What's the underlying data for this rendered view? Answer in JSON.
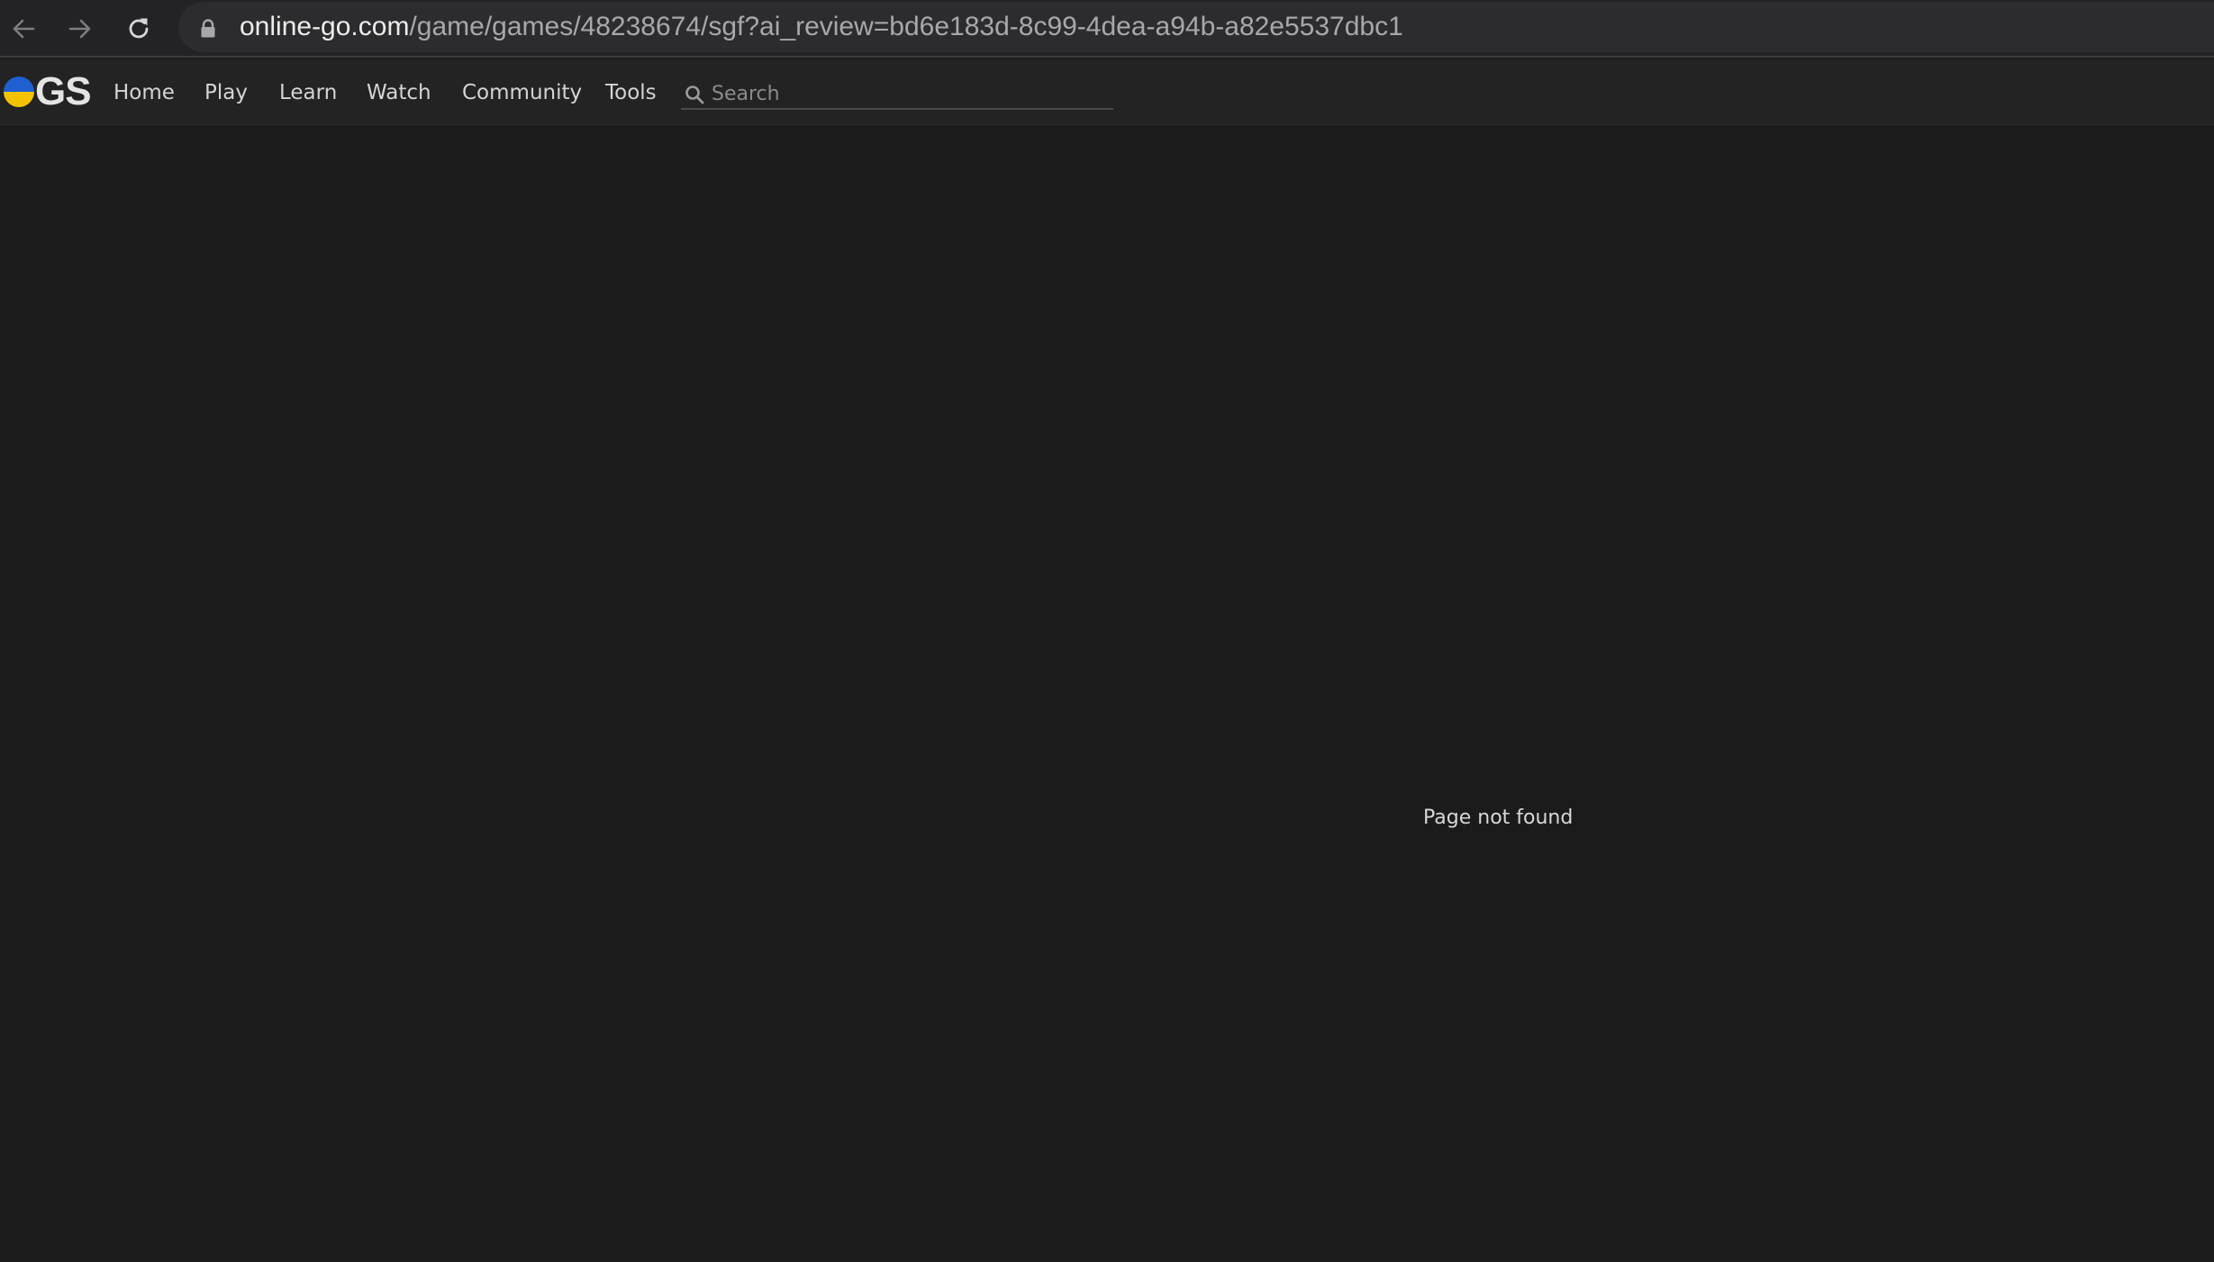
{
  "browser": {
    "url_host": "online-go.com",
    "url_path": "/game/games/48238674/sgf?ai_review=bd6e183d-8c99-4dea-a94b-a82e5537dbc1",
    "icons": [
      "back-arrow-icon",
      "forward-arrow-icon",
      "reload-icon",
      "lock-icon"
    ]
  },
  "site": {
    "logo_text": "GS",
    "nav": [
      {
        "label": "Home"
      },
      {
        "label": "Play"
      },
      {
        "label": "Learn"
      },
      {
        "label": "Watch"
      },
      {
        "label": "Community"
      },
      {
        "label": "Tools"
      }
    ],
    "search": {
      "placeholder": "Search",
      "value": ""
    },
    "colors": {
      "background": "#1b1b1b",
      "navbar": "#232323",
      "flag_blue": "#1f5fd0",
      "flag_yellow": "#f2c200"
    }
  },
  "main": {
    "message": "Page not found"
  }
}
